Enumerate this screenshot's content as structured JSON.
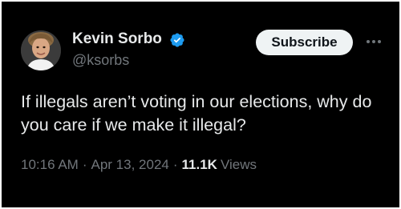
{
  "tweet": {
    "author": {
      "display_name": "Kevin Sorbo",
      "handle": "@ksorbs",
      "avatar_icon": "profile-photo",
      "verified_icon": "verified-badge-icon"
    },
    "subscribe_label": "Subscribe",
    "more_icon": "more-options-icon",
    "text": "If illegals aren’t voting in our elections, why do you care if we make it illegal?",
    "time": "10:16 AM",
    "date": "Apr 13, 2024",
    "separator": "·",
    "views_count": "11.1K",
    "views_label": "Views"
  },
  "colors": {
    "background": "#000000",
    "primary_text": "#e7e9ea",
    "secondary_text": "#71767b",
    "verified_blue": "#1d9bf0",
    "button_bg": "#eff3f4"
  }
}
